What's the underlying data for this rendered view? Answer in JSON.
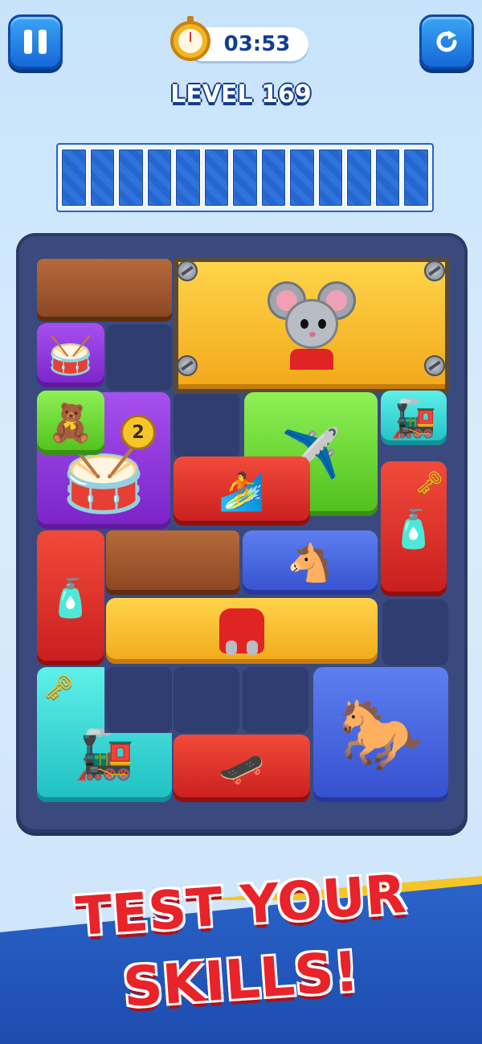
{
  "header": {
    "timer": "03:53",
    "level_label": "LEVEL 169"
  },
  "icons": {
    "pause": "pause-icon",
    "restart": "restart-icon",
    "stopwatch": "stopwatch-icon"
  },
  "slots": {
    "count": 13
  },
  "board": {
    "lock_count": "2",
    "toys": {
      "drum_small": "🥁",
      "drum_big": "🥁",
      "toy_cannon": "🧸",
      "toy_train_small": "🚂",
      "airplane": "✈️",
      "surfboard": "🏄",
      "spray_bottle_a": "🧴",
      "spray_bottle_b": "🧴",
      "horse_head": "🐴",
      "horse_big": "🐎",
      "train": "🚂",
      "skateboard": "🛹",
      "key": "🗝"
    }
  },
  "footer": {
    "tagline_line1": "TEST YOUR",
    "tagline_line2": "SKILLS!"
  },
  "colors": {
    "accent_blue": "#1668d8",
    "board": "#3a4a7e",
    "tagline_red": "#e8232a",
    "stripe_yellow": "#f6c52a"
  }
}
